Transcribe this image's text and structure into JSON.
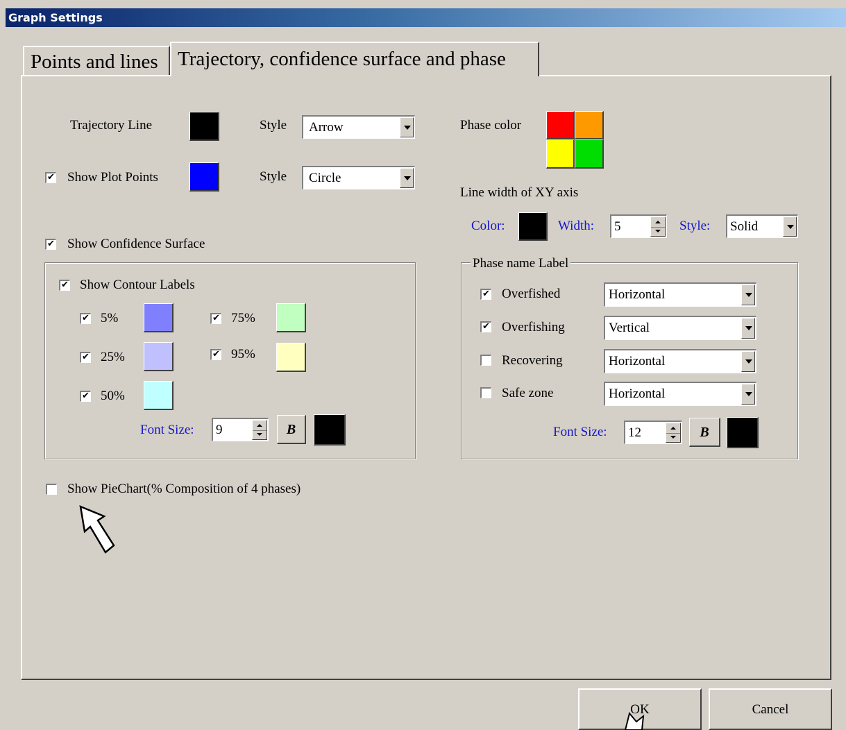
{
  "window": {
    "title": "Graph Settings"
  },
  "tabs": [
    {
      "label": "Points and lines",
      "active": false
    },
    {
      "label": "Trajectory, confidence surface and phase",
      "active": true
    }
  ],
  "trajectory": {
    "label": "Trajectory Line",
    "color": "#000000",
    "style_label": "Style",
    "style_value": "Arrow"
  },
  "plot_points": {
    "label": "Show Plot Points",
    "checked": true,
    "color": "#0000ff",
    "style_label": "Style",
    "style_value": "Circle"
  },
  "confidence": {
    "label": "Show Confidence Surface",
    "checked": true,
    "contour_labels": {
      "label": "Show Contour Labels",
      "checked": true
    },
    "levels": [
      {
        "label": "5%",
        "checked": true,
        "color": "#8080ff"
      },
      {
        "label": "25%",
        "checked": true,
        "color": "#c0c0ff"
      },
      {
        "label": "50%",
        "checked": true,
        "color": "#c0ffff"
      },
      {
        "label": "75%",
        "checked": true,
        "color": "#c0ffc0"
      },
      {
        "label": "95%",
        "checked": true,
        "color": "#ffffc0"
      }
    ],
    "font_size_label": "Font Size:",
    "font_size": "9",
    "bold_label": "B",
    "font_color": "#000000"
  },
  "phase_color": {
    "label": "Phase color",
    "colors": [
      "#ff0000",
      "#ff9900",
      "#ffff00",
      "#00dd00"
    ]
  },
  "xy_axis": {
    "label": "Line width of XY axis",
    "color_label": "Color:",
    "color": "#000000",
    "width_label": "Width:",
    "width": "5",
    "style_label": "Style:",
    "style_value": "Solid"
  },
  "phase_name_label": {
    "legend": "Phase name Label",
    "items": [
      {
        "label": "Overfished",
        "checked": true,
        "orientation": "Horizontal"
      },
      {
        "label": "Overfishing",
        "checked": true,
        "orientation": "Vertical"
      },
      {
        "label": "Recovering",
        "checked": false,
        "orientation": "Horizontal"
      },
      {
        "label": "Safe zone",
        "checked": false,
        "orientation": "Horizontal"
      }
    ],
    "font_size_label": "Font Size:",
    "font_size": "12",
    "bold_label": "B",
    "font_color": "#000000"
  },
  "pie_chart": {
    "label": "Show PieChart(% Composition of 4 phases)",
    "checked": false
  },
  "buttons": {
    "ok": "OK",
    "cancel": "Cancel"
  }
}
